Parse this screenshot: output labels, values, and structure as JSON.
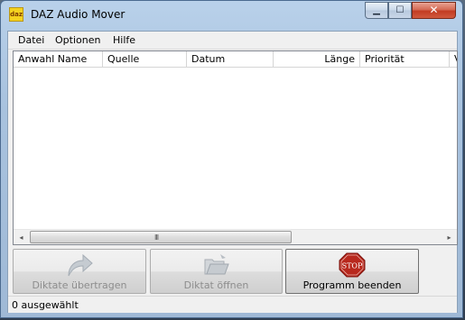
{
  "window": {
    "title": "DAZ Audio Mover",
    "icon_text": "daz",
    "close_glyph": "✕",
    "min_glyph": "▁",
    "max_glyph": "☐"
  },
  "menu": {
    "items": [
      "Datei",
      "Optionen",
      "Hilfe"
    ]
  },
  "list": {
    "columns": [
      "Anwahl Name",
      "Quelle",
      "Datum",
      "Länge",
      "Priorität",
      "V"
    ],
    "rows": []
  },
  "scrollbar": {
    "left_arrow": "◂",
    "right_arrow": "▸",
    "grip": "III"
  },
  "buttons": {
    "transfer": {
      "label": "Diktate übertragen",
      "icon": "curved-arrow-icon",
      "enabled": false
    },
    "open": {
      "label": "Diktat öffnen",
      "icon": "open-folder-icon",
      "enabled": false
    },
    "quit": {
      "label": "Programm beenden",
      "icon": "stop-sign-icon",
      "icon_text": "STOP",
      "enabled": true
    }
  },
  "status": {
    "text": "0 ausgewählt"
  },
  "colors": {
    "stop_red": "#b8281d",
    "disabled_text": "#8d8d8d"
  }
}
